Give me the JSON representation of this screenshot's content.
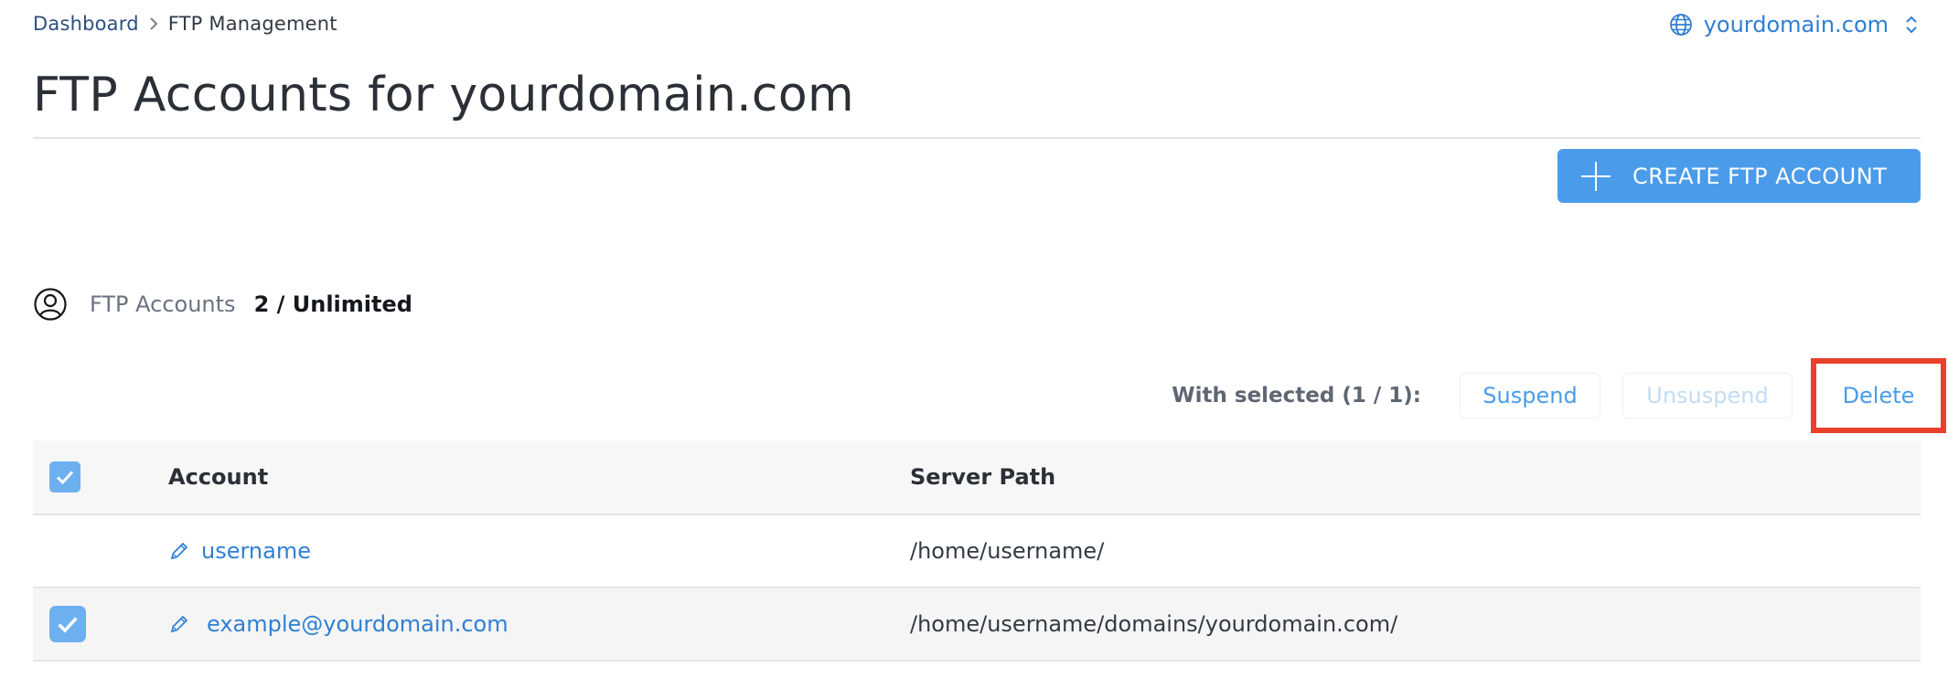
{
  "breadcrumb": {
    "home": "Dashboard",
    "current": "FTP Management"
  },
  "domain_selector": {
    "value": "yourdomain.com",
    "icon": "globe-icon",
    "chevron_icon": "chevron-up-down-icon"
  },
  "page": {
    "title": "FTP Accounts for yourdomain.com"
  },
  "create_button": {
    "label": "CREATE FTP ACCOUNT",
    "icon": "plus-icon"
  },
  "stats": {
    "icon": "user-circle-icon",
    "label": "FTP Accounts",
    "value": "2 / Unlimited"
  },
  "bulk_actions": {
    "label": "With selected (1 / 1):",
    "suspend": "Suspend",
    "unsuspend": "Unsuspend",
    "delete": "Delete"
  },
  "table": {
    "columns": {
      "account": "Account",
      "server_path": "Server Path"
    },
    "rows": [
      {
        "account": "username",
        "server_path": "/home/username/",
        "selected": false
      },
      {
        "account": "example@yourdomain.com",
        "server_path": "/home/username/domains/yourdomain.com/",
        "selected": true
      }
    ]
  },
  "colors": {
    "accent": "#4a9cea",
    "link": "#2f7fd4",
    "highlight_border": "#e8412b",
    "checkbox": "#6db0f0",
    "disabled_text": "#c3dcf5"
  }
}
